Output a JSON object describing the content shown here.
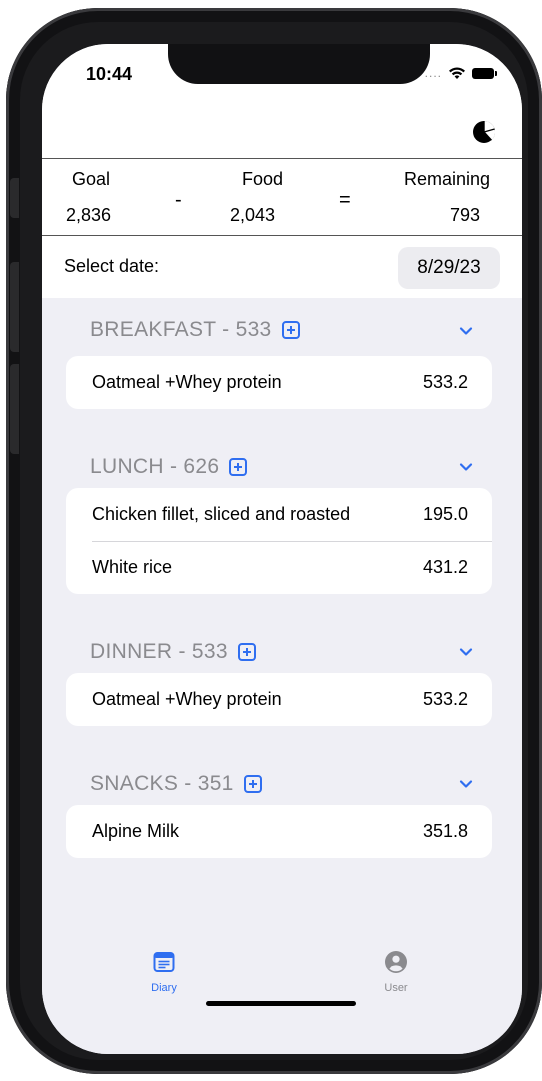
{
  "status_bar": {
    "time": "10:44",
    "signal_dots": "....",
    "icons": [
      "wifi-icon",
      "battery-icon"
    ]
  },
  "nav": {
    "chart_icon": "pie-chart-icon"
  },
  "summary": {
    "goal_label": "Goal",
    "goal_value": "2,836",
    "minus": "-",
    "food_label": "Food",
    "food_value": "2,043",
    "equals": "=",
    "remaining_label": "Remaining",
    "remaining_value": "793"
  },
  "date": {
    "label": "Select date:",
    "value": "8/29/23"
  },
  "meals": [
    {
      "title": "BREAKFAST - 533",
      "items": [
        {
          "name": "Oatmeal +Whey protein",
          "calories": "533.2"
        }
      ]
    },
    {
      "title": "LUNCH - 626",
      "items": [
        {
          "name": "Chicken fillet, sliced and roasted",
          "calories": "195.0"
        },
        {
          "name": "White rice",
          "calories": "431.2"
        }
      ]
    },
    {
      "title": "DINNER - 533",
      "items": [
        {
          "name": "Oatmeal +Whey protein",
          "calories": "533.2"
        }
      ]
    },
    {
      "title": "SNACKS - 351",
      "items": [
        {
          "name": "Alpine Milk",
          "calories": "351.8"
        }
      ]
    }
  ],
  "tab_bar": {
    "tabs": [
      {
        "label": "Diary",
        "icon": "diary-icon",
        "selected": true
      },
      {
        "label": "User",
        "icon": "user-icon",
        "selected": false
      }
    ]
  },
  "colors": {
    "accent": "#2f6ef0",
    "background": "#efeff5",
    "section_header": "#8a8a8e",
    "inactive_tab": "#8a8a8e"
  }
}
